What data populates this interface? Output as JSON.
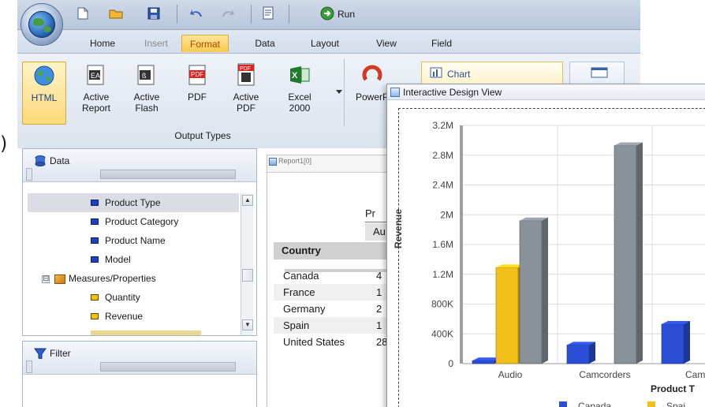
{
  "quick_access": {
    "run_label": "Run"
  },
  "tabs": [
    {
      "label": "Home",
      "state": "normal"
    },
    {
      "label": "Insert",
      "state": "disabled"
    },
    {
      "label": "Format",
      "state": "active"
    },
    {
      "label": "Data",
      "state": "normal"
    },
    {
      "label": "Layout",
      "state": "normal"
    },
    {
      "label": "View",
      "state": "normal"
    },
    {
      "label": "Field",
      "state": "normal"
    }
  ],
  "ribbon": {
    "buttons": [
      {
        "line1": "HTML",
        "line2": "",
        "icon": "html-globe-icon",
        "selected": true
      },
      {
        "line1": "Active",
        "line2": "Report",
        "icon": "active-report-icon",
        "selected": false
      },
      {
        "line1": "Active",
        "line2": "Flash",
        "icon": "active-flash-icon",
        "selected": false
      },
      {
        "line1": "PDF",
        "line2": "",
        "icon": "pdf-icon",
        "selected": false
      },
      {
        "line1": "Active",
        "line2": "PDF",
        "icon": "active-pdf-icon",
        "selected": false
      },
      {
        "line1": "Excel",
        "line2": "2000",
        "icon": "excel-icon",
        "selected": false
      },
      {
        "line1": "PowerP",
        "line2": "",
        "icon": "powerpoint-icon",
        "selected": false
      }
    ],
    "group_label": "Output Types",
    "chart_button_label": "Chart"
  },
  "data_panel": {
    "title": "Data",
    "items": [
      {
        "label": "Product Type",
        "kind": "dimension",
        "level": 2,
        "highlighted": true
      },
      {
        "label": "Product Category",
        "kind": "dimension",
        "level": 2,
        "highlighted": false
      },
      {
        "label": "Product Name",
        "kind": "dimension",
        "level": 2,
        "highlighted": false
      },
      {
        "label": "Model",
        "kind": "dimension",
        "level": 2,
        "highlighted": false
      },
      {
        "label": "Measures/Properties",
        "kind": "folder",
        "level": 1,
        "highlighted": false,
        "expander": "⊟"
      },
      {
        "label": "Quantity",
        "kind": "measure",
        "level": 2,
        "highlighted": false
      },
      {
        "label": "Revenue",
        "kind": "measure",
        "level": 2,
        "highlighted": false
      }
    ]
  },
  "filter_panel": {
    "title": "Filter"
  },
  "report": {
    "tab_label": "Report1[0]",
    "header_partial": "Pr",
    "subheader_partial": "Au",
    "country_header": "Country",
    "rows": [
      {
        "country": "Canada",
        "value_partial": "4"
      },
      {
        "country": "France",
        "value_partial": "1"
      },
      {
        "country": "Germany",
        "value_partial": "2"
      },
      {
        "country": "Spain",
        "value_partial": "1"
      },
      {
        "country": "United States",
        "value_partial": "28"
      }
    ]
  },
  "design_view": {
    "title": "Interactive Design View"
  },
  "colors": {
    "canada": "#2a4fd6",
    "spain": "#f3c01a",
    "third_series": "#8a9299",
    "accent_tab": "#fbc94d"
  },
  "chart_data": {
    "type": "bar",
    "ylabel": "Revenue",
    "xlabel": "Product T",
    "categories": [
      "Audio",
      "Camcorders",
      "Camer"
    ],
    "yticks": [
      "0",
      "400K",
      "800K",
      "1.2M",
      "1.6M",
      "2M",
      "2.4M",
      "2.8M",
      "3.2M"
    ],
    "ylim": [
      0,
      3200000
    ],
    "series": [
      {
        "name": "Canada",
        "color": "#2a4fd6",
        "values": [
          40000,
          250000,
          530000
        ]
      },
      {
        "name": "Spai",
        "color": "#f3c01a",
        "values": [
          1290000,
          null,
          null
        ]
      },
      {
        "name": "",
        "color": "#8a9299",
        "values": [
          1920000,
          2930000,
          null
        ]
      }
    ],
    "legend": [
      "Canada",
      "Spai"
    ],
    "grid": true
  }
}
